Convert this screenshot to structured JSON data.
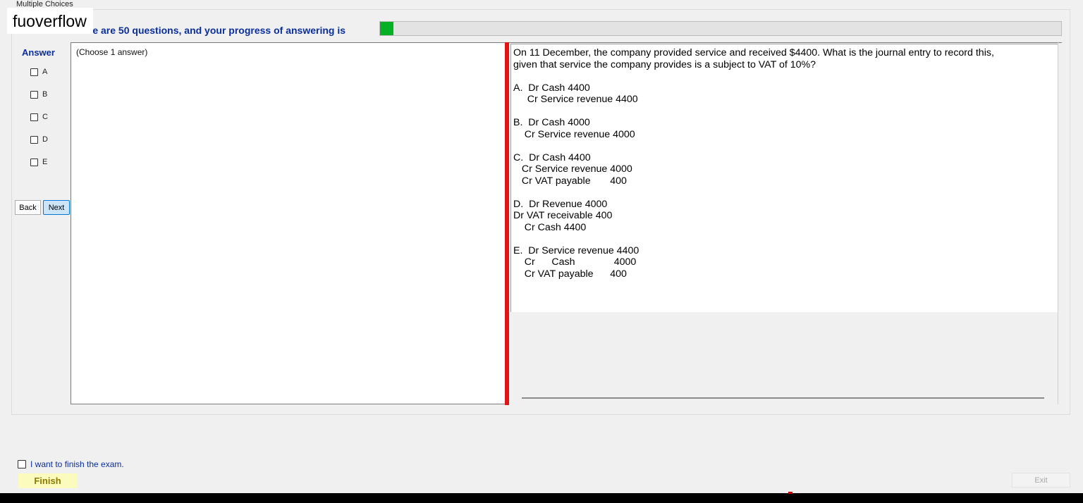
{
  "window": {
    "group_title": "Multiple Choices"
  },
  "overlay": {
    "watermark": "fuoverflow"
  },
  "progress": {
    "text": "There are 50 questions, and your progress of answering is",
    "fraction": 0.02,
    "fill_color": "#06b025"
  },
  "answer_panel": {
    "label": "Answer",
    "options": [
      "A",
      "B",
      "C",
      "D",
      "E"
    ],
    "back_label": "Back",
    "next_label": "Next",
    "hint": "(Choose 1 answer)"
  },
  "question": {
    "text": "On 11 December, the company provided service and received $4400. What is the journal entry to record this,\ngiven that service the company provides is a subject to VAT of 10%?\n\nA.  Dr Cash 4400\n     Cr Service revenue 4400\n\nB.  Dr Cash 4000\n    Cr Service revenue 4000\n\nC.  Dr Cash 4400\n   Cr Service revenue 4000\n   Cr VAT payable       400\n\nD.  Dr Revenue 4000\nDr VAT receivable 400\n    Cr Cash 4400\n\nE.  Dr Service revenue 4400\n    Cr      Cash              4000\n    Cr VAT payable      400"
  },
  "footer": {
    "finish_check_label": "I want to finish the exam.",
    "finish_label": "Finish",
    "exit_label": "Exit"
  },
  "colors": {
    "accent_text": "#0a2f9c",
    "splitter": "#e01515",
    "finish_bg": "#fbfbbe"
  }
}
